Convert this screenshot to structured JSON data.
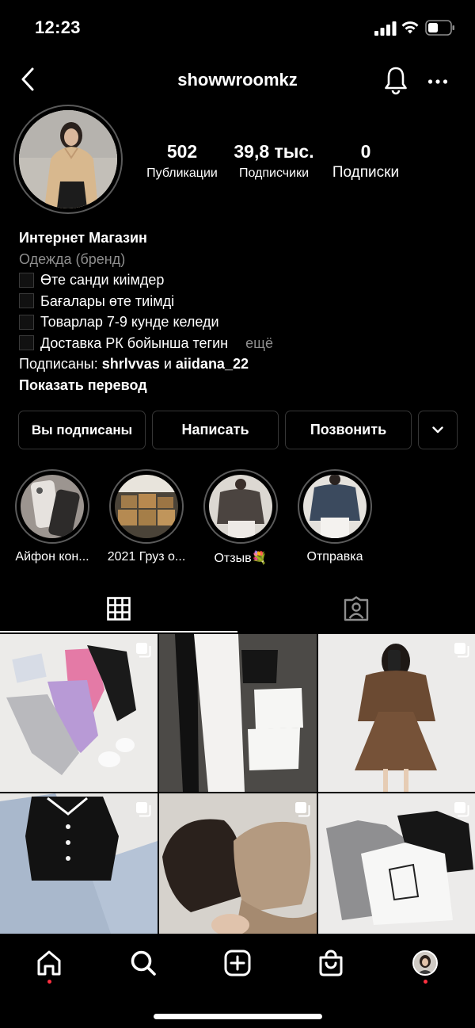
{
  "status_bar": {
    "time": "12:23"
  },
  "header": {
    "username": "showwroomkz"
  },
  "profile": {
    "stats": [
      {
        "number": "502",
        "label": "Публикации"
      },
      {
        "number": "39,8 тыс.",
        "label": "Подписчики"
      },
      {
        "number": "0",
        "label": "Подписки"
      }
    ],
    "bio": {
      "name": "Интернет Магазин",
      "category": "Одежда (бренд)",
      "lines": [
        "Өте санди киімдер",
        "Бағалары өте тиімді",
        "Товарлар 7-9 кунде келеди",
        "Доставка РК бойынша тегин"
      ],
      "more": "ещё",
      "followed_prefix": "Подписаны:",
      "followed_user1": "shrlvvas",
      "followed_and": "и",
      "followed_user2": "aiidana_22",
      "translate": "Показать перевод"
    }
  },
  "buttons": {
    "following": "Вы подписаны",
    "message": "Написать",
    "call": "Позвонить"
  },
  "highlights": [
    {
      "label": "Айфон кон..."
    },
    {
      "label": "2021 Груз о..."
    },
    {
      "label": "Отзыв💐"
    },
    {
      "label": "Отправка"
    }
  ],
  "colors": {
    "background": "#000000",
    "border": "#363636",
    "secondary_text": "#8e8e8e",
    "notification_dot": "#ff3040"
  },
  "icons": {
    "back": "chevron-left-icon",
    "bell": "bell-icon",
    "more": "more-horizontal-icon",
    "dropdown": "chevron-down-icon",
    "grid": "grid-icon",
    "tagged": "tagged-person-icon",
    "home": "home-icon",
    "search": "search-icon",
    "create": "plus-square-icon",
    "shop": "shopping-bag-icon"
  }
}
